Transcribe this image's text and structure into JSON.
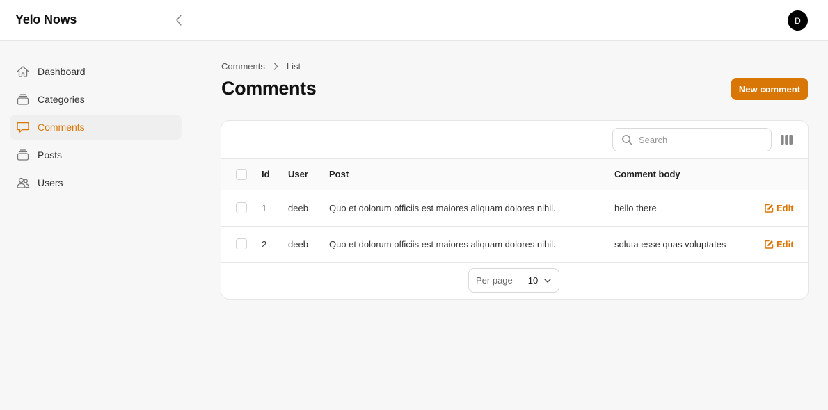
{
  "app": {
    "title": "Yelo Nows",
    "user_initial": "D"
  },
  "sidebar": {
    "items": [
      {
        "label": "Dashboard",
        "icon": "home-icon",
        "active": false
      },
      {
        "label": "Categories",
        "icon": "collection-icon",
        "active": false
      },
      {
        "label": "Comments",
        "icon": "chat-icon",
        "active": true
      },
      {
        "label": "Posts",
        "icon": "collection-icon",
        "active": false
      },
      {
        "label": "Users",
        "icon": "users-icon",
        "active": false
      }
    ]
  },
  "breadcrumb": {
    "parent": "Comments",
    "current": "List"
  },
  "page": {
    "title": "Comments",
    "new_button_label": "New comment"
  },
  "search": {
    "placeholder": "Search",
    "value": ""
  },
  "table": {
    "columns": {
      "id": "Id",
      "user": "User",
      "post": "Post",
      "body": "Comment body"
    },
    "rows": [
      {
        "id": "1",
        "user": "deeb",
        "post": "Quo et dolorum officiis est maiores aliquam dolores nihil.",
        "body": "hello there",
        "action": "Edit"
      },
      {
        "id": "2",
        "user": "deeb",
        "post": "Quo et dolorum officiis est maiores aliquam dolores nihil.",
        "body": "soluta esse quas voluptates",
        "action": "Edit"
      }
    ]
  },
  "pagination": {
    "per_page_label": "Per page",
    "per_page_value": "10"
  },
  "colors": {
    "accent": "#d97706",
    "active_bg": "#efefef",
    "border": "#e6e6e6"
  }
}
